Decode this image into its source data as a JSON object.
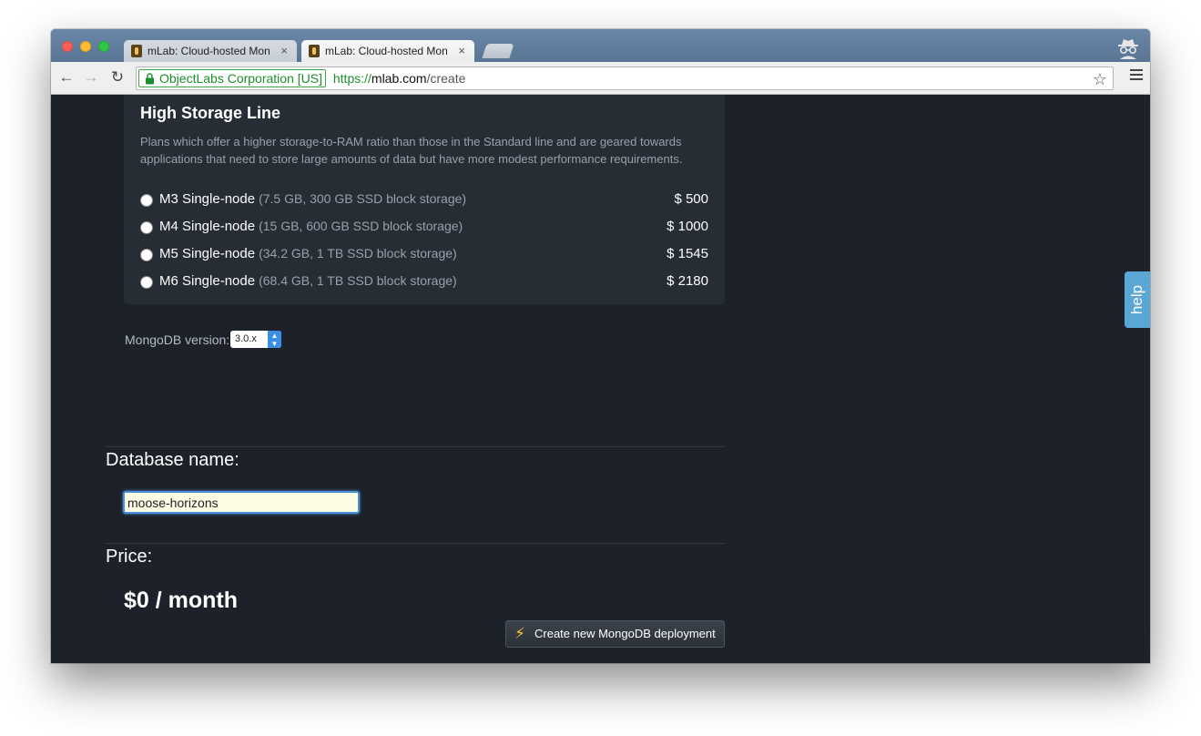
{
  "browser": {
    "tabs": [
      {
        "title": "mLab: Cloud-hosted MongoDB",
        "active": false
      },
      {
        "title": "mLab: Cloud-hosted MongoDB",
        "active": true
      }
    ],
    "close_glyph": "×",
    "ev_cert": "ObjectLabs Corporation [US]",
    "url": {
      "scheme": "https://",
      "host": "mlab.com",
      "path": "/create"
    }
  },
  "plan_panel": {
    "title": "High Storage Line",
    "description": "Plans which offer a higher storage-to-RAM ratio than those in the Standard line and are geared towards applications that need to store large amounts of data but have more modest performance requirements.",
    "plans": [
      {
        "name": "M3 Single-node",
        "spec": "(7.5 GB, 300 GB SSD block storage)",
        "price": "$ 500",
        "selected": false
      },
      {
        "name": "M4 Single-node",
        "spec": "(15 GB, 600 GB SSD block storage)",
        "price": "$ 1000",
        "selected": false
      },
      {
        "name": "M5 Single-node",
        "spec": "(34.2 GB, 1 TB SSD block storage)",
        "price": "$ 1545",
        "selected": false
      },
      {
        "name": "M6 Single-node",
        "spec": "(68.4 GB, 1 TB SSD block storage)",
        "price": "$ 2180",
        "selected": false
      }
    ]
  },
  "version": {
    "label": "MongoDB version:",
    "selected": "3.0.x"
  },
  "database": {
    "label": "Database name:",
    "value": "moose-horizons"
  },
  "price": {
    "label": "Price:",
    "value": "$0 / month"
  },
  "create_button": {
    "label": "Create new MongoDB deployment",
    "icon": "bolt-icon"
  },
  "help": {
    "label": "help"
  },
  "colors": {
    "accent": "#5aa7d6",
    "page_bg": "#1d222a",
    "panel_bg": "#272d35",
    "ev_green": "#1e8e2d"
  }
}
